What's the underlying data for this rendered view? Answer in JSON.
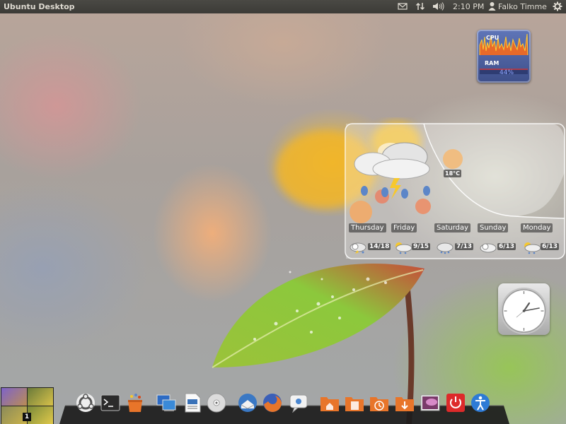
{
  "top_panel": {
    "title": "Ubuntu Desktop",
    "time": "2:10 PM",
    "user": "Falko Timme",
    "icons": [
      "mail-icon",
      "network-icon",
      "volume-icon",
      "user-icon",
      "gear-icon"
    ]
  },
  "system_monitor": {
    "cpu_label": "CPU",
    "ram_label": "RAM",
    "ram_value": "44%"
  },
  "weather": {
    "current_temp": "18°C",
    "forecast": [
      {
        "day": "Thursday",
        "temps": "14/18"
      },
      {
        "day": "Friday",
        "temps": "9/15"
      },
      {
        "day": "Saturday",
        "temps": "7/13"
      },
      {
        "day": "Sunday",
        "temps": "6/13"
      },
      {
        "day": "Monday",
        "temps": "6/13"
      }
    ]
  },
  "workspace": {
    "current": "1"
  },
  "dock": {
    "items": [
      "ubuntu-logo-icon",
      "terminal-icon",
      "software-center-icon",
      "remote-desktop-icon",
      "document-viewer-icon",
      "cd-icon",
      "thunderbird-icon",
      "firefox-icon",
      "chat-icon",
      "home-folder-icon",
      "documents-folder-icon",
      "recent-folder-icon",
      "downloads-folder-icon",
      "wallpaper-icon",
      "shutdown-icon",
      "accessibility-icon"
    ]
  },
  "colors": {
    "panel": "#3c3b37",
    "accent_orange": "#e8752a",
    "ubuntu_red": "#dd4814"
  }
}
